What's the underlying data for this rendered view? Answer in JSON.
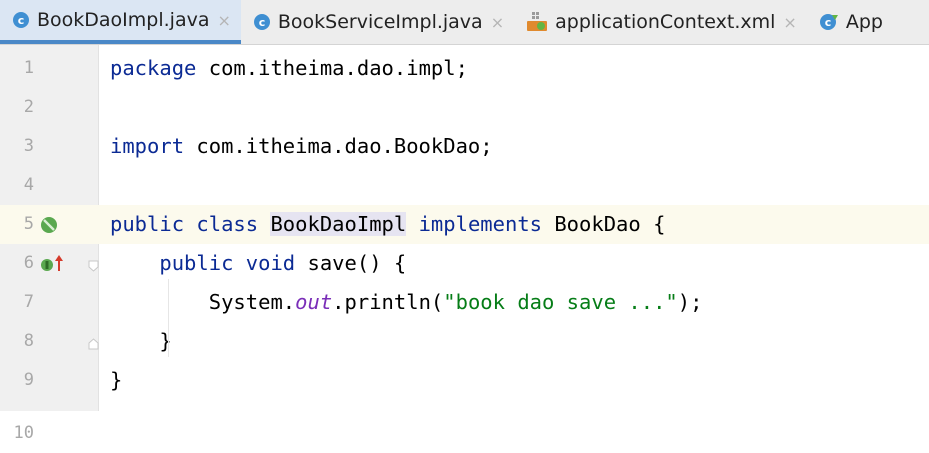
{
  "tabs": [
    {
      "label": "BookDaoImpl.java",
      "icon": "java-class-icon",
      "active": true
    },
    {
      "label": "BookServiceImpl.java",
      "icon": "java-class-icon",
      "active": false
    },
    {
      "label": "applicationContext.xml",
      "icon": "xml-spring-icon",
      "active": false
    },
    {
      "label": "App",
      "icon": "java-app-class-icon",
      "active": false
    }
  ],
  "close_glyph": "×",
  "colors": {
    "keyword": "#0b2a94",
    "string": "#067d17",
    "static_field": "#7a2eb8",
    "implement_icon": "#5aa84f",
    "override_arrow": "#d53a2b"
  },
  "lines": [
    {
      "num": "1",
      "tokens": [
        {
          "t": "package",
          "c": "kw"
        },
        {
          "t": " com.itheima.dao.impl;",
          "c": ""
        }
      ]
    },
    {
      "num": "2",
      "tokens": []
    },
    {
      "num": "3",
      "tokens": [
        {
          "t": "import",
          "c": "kw"
        },
        {
          "t": " com.itheima.dao.BookDao;",
          "c": ""
        }
      ]
    },
    {
      "num": "4",
      "tokens": []
    },
    {
      "num": "5",
      "tokens": [
        {
          "t": "public",
          "c": "kw"
        },
        {
          "t": " ",
          "c": ""
        },
        {
          "t": "class",
          "c": "kw"
        },
        {
          "t": " ",
          "c": ""
        },
        {
          "t": "BookDaoImpl",
          "c": "hl"
        },
        {
          "t": " ",
          "c": ""
        },
        {
          "t": "implements",
          "c": "kw"
        },
        {
          "t": " BookDao {",
          "c": ""
        }
      ]
    },
    {
      "num": "6",
      "tokens": [
        {
          "t": "    ",
          "c": ""
        },
        {
          "t": "public",
          "c": "kw"
        },
        {
          "t": " ",
          "c": ""
        },
        {
          "t": "void",
          "c": "kw"
        },
        {
          "t": " save() {",
          "c": ""
        }
      ]
    },
    {
      "num": "7",
      "tokens": [
        {
          "t": "        System.",
          "c": ""
        },
        {
          "t": "out",
          "c": "fld"
        },
        {
          "t": ".println(",
          "c": ""
        },
        {
          "t": "\"book dao save ...\"",
          "c": "str"
        },
        {
          "t": ");",
          "c": ""
        }
      ]
    },
    {
      "num": "8",
      "tokens": [
        {
          "t": "    }",
          "c": ""
        }
      ]
    },
    {
      "num": "9",
      "tokens": [
        {
          "t": "}",
          "c": ""
        }
      ]
    },
    {
      "num": "10",
      "tokens": []
    }
  ]
}
